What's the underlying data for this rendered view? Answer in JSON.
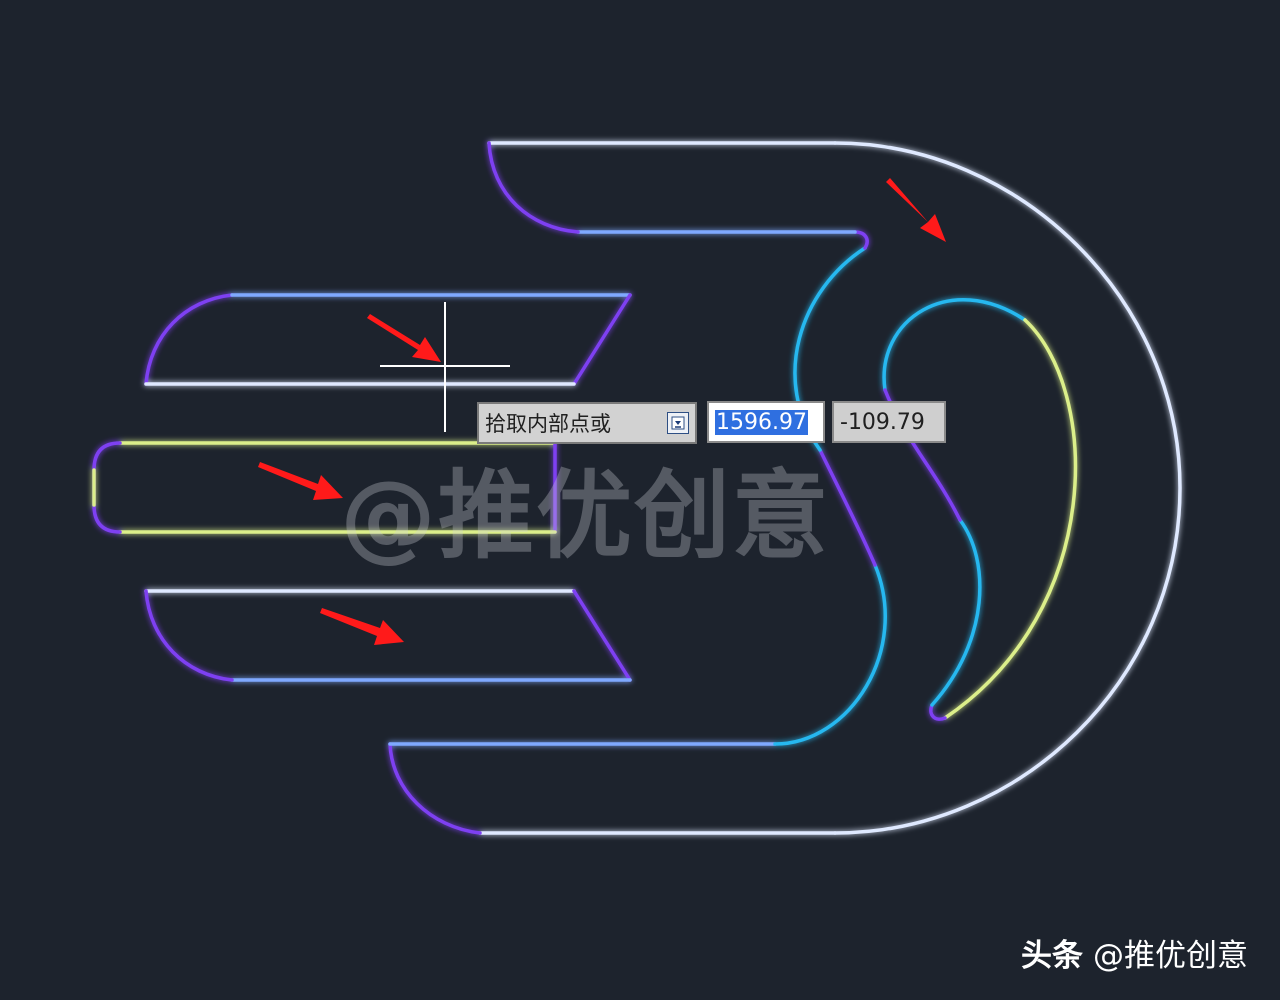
{
  "prompt": {
    "label": "拾取内部点或",
    "icon": "dropdown-arrow-icon"
  },
  "coordinates": {
    "x_value": "1596.97",
    "y_value": "-109.79"
  },
  "watermark": {
    "text": "@推优创意"
  },
  "brand": {
    "platform": "头条",
    "handle": "@推优创意"
  },
  "colors": {
    "background": "#1d232d",
    "line_white": "#dfe9ff",
    "line_cyan": "#27b8f0",
    "line_purple": "#7e3ff2",
    "line_yellow": "#dcef8a",
    "arrow_red": "#ff1a1a",
    "crosshair": "#ffffff"
  },
  "icons": [
    "crosshair-cursor-icon",
    "red-arrow-icon",
    "dropdown-arrow-icon"
  ]
}
